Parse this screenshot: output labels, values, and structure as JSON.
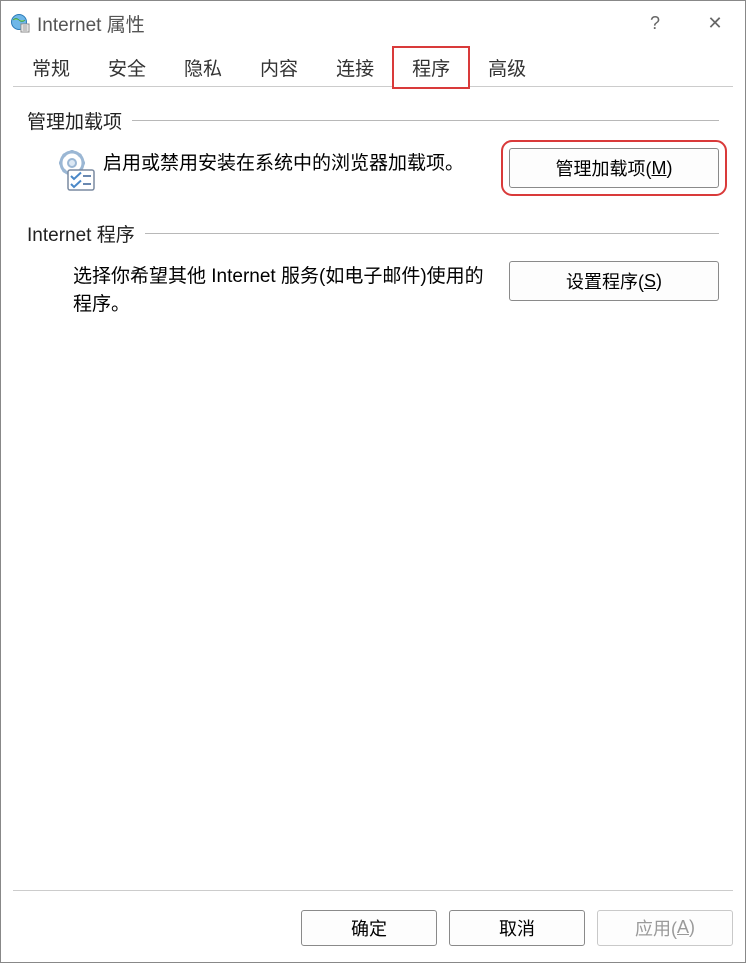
{
  "title": "Internet 属性",
  "titlebar": {
    "help_symbol": "?",
    "close_symbol": "✕"
  },
  "tabs": [
    {
      "label": "常规",
      "active": false
    },
    {
      "label": "安全",
      "active": false
    },
    {
      "label": "隐私",
      "active": false
    },
    {
      "label": "内容",
      "active": false
    },
    {
      "label": "连接",
      "active": false
    },
    {
      "label": "程序",
      "active": true,
      "highlight": true
    },
    {
      "label": "高级",
      "active": false
    }
  ],
  "groups": {
    "addons": {
      "title": "管理加载项",
      "description": "启用或禁用安装在系统中的浏览器加载项。",
      "button_prefix": "管理加载项(",
      "button_key": "M",
      "button_suffix": ")"
    },
    "programs": {
      "title": "Internet 程序",
      "description": "选择你希望其他 Internet 服务(如电子邮件)使用的程序。",
      "button_prefix": "设置程序(",
      "button_key": "S",
      "button_suffix": ")"
    }
  },
  "footer": {
    "ok": "确定",
    "cancel": "取消",
    "apply_prefix": "应用(",
    "apply_key": "A",
    "apply_suffix": ")"
  }
}
